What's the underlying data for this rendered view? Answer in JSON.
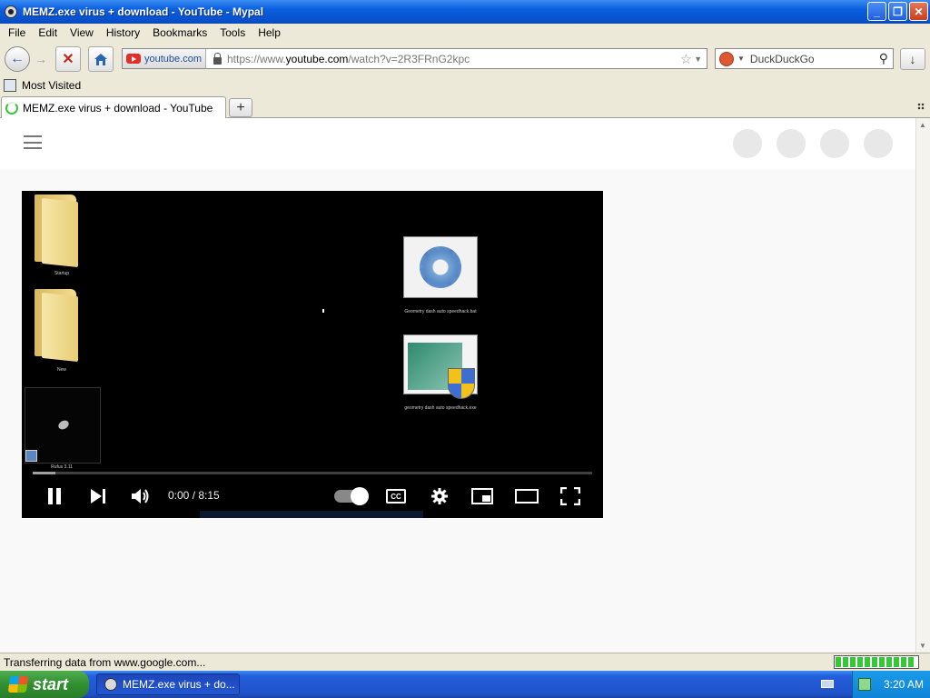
{
  "window": {
    "title": "MEMZ.exe virus + download - YouTube - Mypal",
    "minimize": "_",
    "restore": "❐",
    "close": "✕"
  },
  "menu": [
    "File",
    "Edit",
    "View",
    "History",
    "Bookmarks",
    "Tools",
    "Help"
  ],
  "nav": {
    "site_identity": "youtube.com",
    "url_prefix": "https://www.",
    "url_domain": "youtube.com",
    "url_path": "/watch?v=2R3FRnG2kpc",
    "search_engine": "DuckDuckGo"
  },
  "bookmarks": {
    "most_visited": "Most Visited"
  },
  "tabs": [
    {
      "title": "MEMZ.exe virus + download - YouTube",
      "loading": true
    }
  ],
  "page": {
    "player": {
      "folder1_label": "Startup",
      "folder2_label": "New",
      "gear_label": "Geometry dash auto speedhack.bat",
      "installer_label": "geometry dash auto speedhack.exe",
      "small_window_label": "Rufus 3.11",
      "time": "0:00 / 8:15",
      "cc": "CC",
      "progress": 0.0,
      "buffered": 0.04
    }
  },
  "status": {
    "text": "Transferring data from www.google.com...",
    "progress": 0.95
  },
  "taskbar": {
    "start": "start",
    "task_title": "MEMZ.exe virus + do...",
    "clock": "3:20 AM"
  },
  "colors": {
    "xp_blue": "#0a5fe0",
    "start_green": "#318f31",
    "youtube_red": "#e52d27"
  }
}
